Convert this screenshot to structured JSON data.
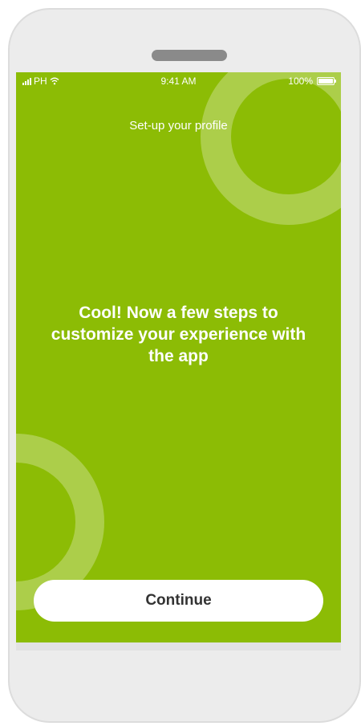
{
  "status_bar": {
    "carrier": "PH",
    "time": "9:41 AM",
    "battery": "100%"
  },
  "header": {
    "title": "Set-up your profile"
  },
  "main": {
    "message": "Cool! Now a few steps to customize your experience with the app"
  },
  "actions": {
    "continue_label": "Continue"
  },
  "colors": {
    "screen_background": "#8cbc05",
    "button_background": "#ffffff",
    "button_text": "#333333"
  },
  "icons": [
    "signal-icon",
    "wifi-icon",
    "battery-icon"
  ]
}
